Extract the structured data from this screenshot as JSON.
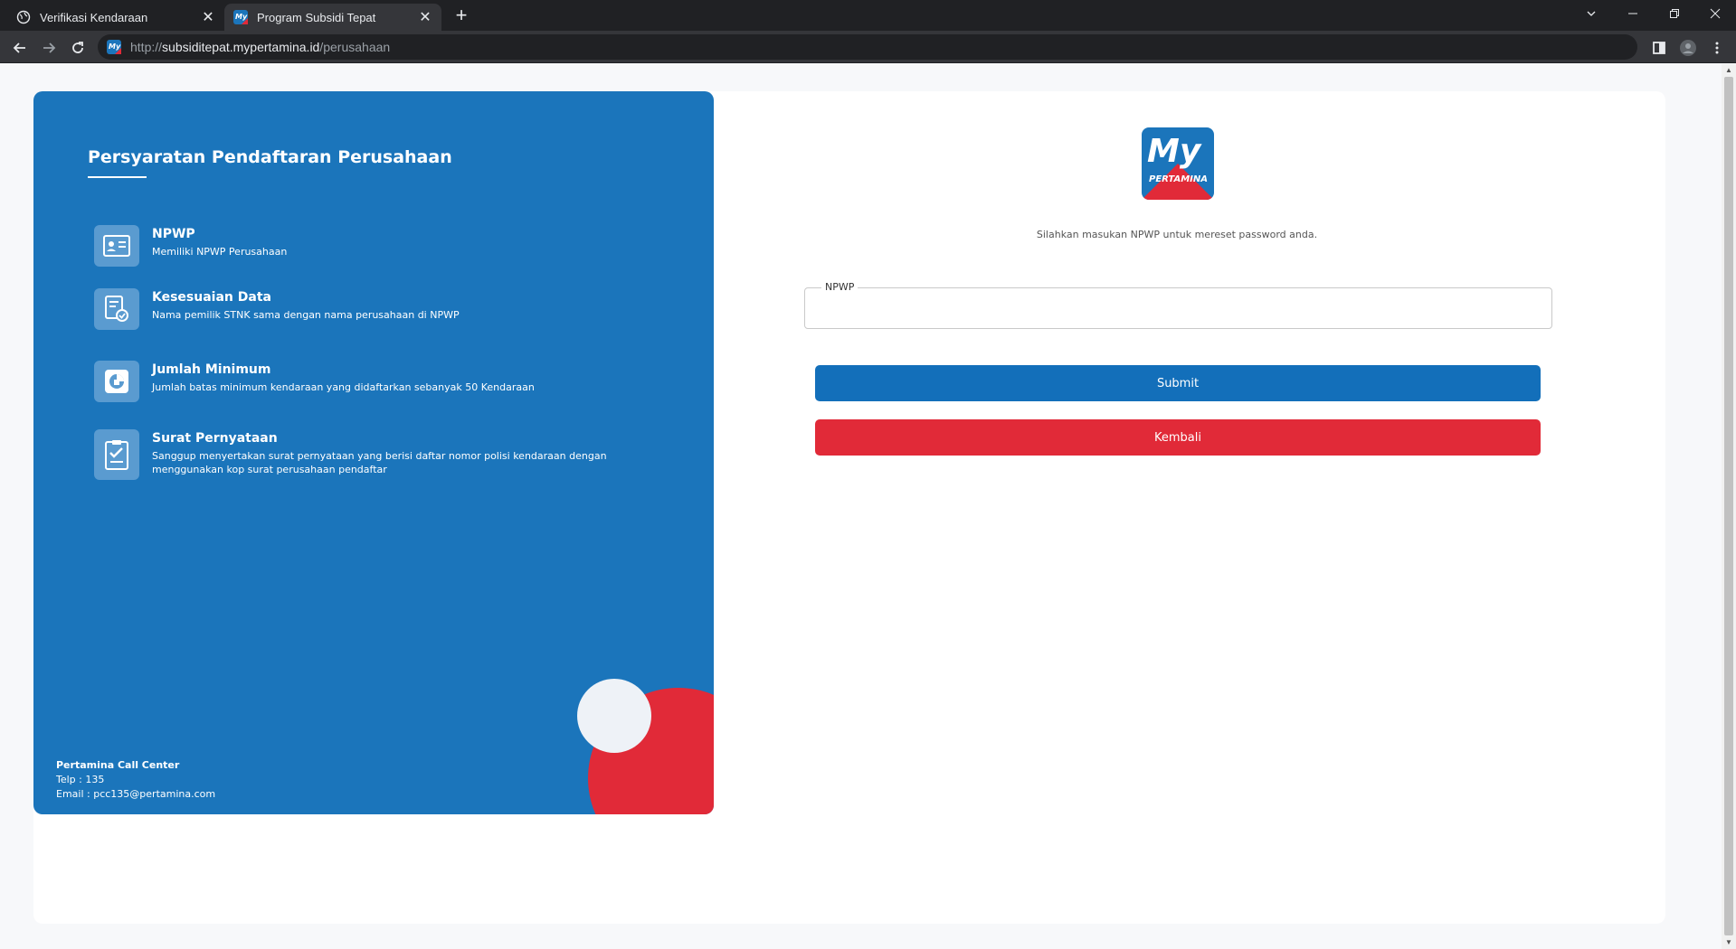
{
  "browser": {
    "tabs": [
      {
        "title": "Verifikasi Kendaraan",
        "close": "✕"
      },
      {
        "title": "Program Subsidi Tepat",
        "close": "✕"
      }
    ],
    "new_tab": "+",
    "url": {
      "scheme": "http://",
      "host": "subsiditepat.mypertamina.id",
      "path": "/perusahaan"
    },
    "icons": [
      "globe-icon",
      "back-icon",
      "forward-icon",
      "reload-icon",
      "side-panel-icon",
      "profile-icon",
      "menu-icon"
    ]
  },
  "left_panel": {
    "title": "Persyaratan Pendaftaran Perusahaan",
    "requirements": [
      {
        "icon": "id-card-icon",
        "title": "NPWP",
        "desc": "Memiliki NPWP Perusahaan"
      },
      {
        "icon": "document-check-icon",
        "title": "Kesesuaian Data",
        "desc": "Nama pemilik STNK sama dengan nama perusahaan di NPWP"
      },
      {
        "icon": "minimum-count-icon",
        "title": "Jumlah Minimum",
        "desc": "Jumlah batas minimum kendaraan yang didaftarkan sebanyak 50 Kendaraan"
      },
      {
        "icon": "checklist-icon",
        "title": "Surat Pernyataan",
        "desc": "Sanggup menyertakan surat pernyataan yang berisi daftar nomor polisi kendaraan dengan menggunakan kop surat perusahaan pendaftar"
      }
    ],
    "call_center": {
      "title": "Pertamina Call Center",
      "phone": "Telp : 135",
      "email": "Email : pcc135@pertamina.com"
    }
  },
  "form": {
    "logo": {
      "my": "My",
      "brand": "PERTAMINA"
    },
    "info_text": "Silahkan masukan NPWP untuk mereset password anda.",
    "npwp_label": "NPWP",
    "npwp_value": "",
    "submit_label": "Submit",
    "back_label": "Kembali"
  },
  "colors": {
    "primary": "#1b75bb",
    "danger": "#e12a38"
  }
}
